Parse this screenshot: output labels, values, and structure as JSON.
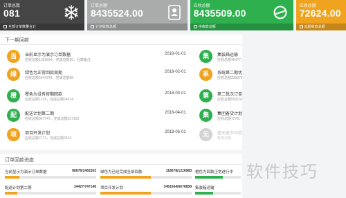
{
  "colors": {
    "black_card": "#454545",
    "grey_card": "#a9acab",
    "green_card": "#2eb04e",
    "orange_card": "#f0a31f",
    "orange_circle": "#f0a31f",
    "green_circle": "#2eb04e",
    "grey_circle": "#d3d3d3",
    "progress_orange": "#f0a31f",
    "progress_green": "#2eb04e"
  },
  "cards": [
    {
      "title": "订单总数",
      "value": "081",
      "footer": "全部订单数量合计",
      "icon": "snowflake-icon"
    },
    {
      "title": "订单总额",
      "value": "8435524.00",
      "footer": "计划收款总额",
      "icon": "contact-card-icon"
    },
    {
      "title": "应收总额",
      "value": "8435509.00",
      "footer": "待收款总额",
      "icon": "refresh-icon"
    },
    {
      "title": "应收总额",
      "value": "72624.00",
      "footer": "延期收款总额",
      "icon": ""
    }
  ],
  "period": {
    "title": "下一期回款",
    "left": [
      {
        "badge": "当",
        "name": "当前显示为演示订单数据",
        "sub": "应收总额1353564，完成总额25，回款备注",
        "date": "2018-01-01"
      },
      {
        "badge": "绿",
        "name": "绿色为正常回款周期",
        "sub": "应收总额5444378，完成总额98",
        "date": "2018-02-01"
      },
      {
        "badge": "橙",
        "name": "橙色为没有按期回款",
        "sub": "应收总额1218，完成总额64614",
        "date": "2018-03-01"
      },
      {
        "badge": "配",
        "name": "配送计划第二期",
        "sub": "应收总额347747，完成总额227155",
        "date": "2018-04-01"
      },
      {
        "badge": "项",
        "name": "项目开发计划",
        "sub": "应收总额7171，完成总额2543",
        "date": "2018-05-01"
      }
    ],
    "right": [
      {
        "badge": "集",
        "name": "集装箱运输",
        "sub": "应收总额45477，完成总额665881"
      },
      {
        "badge": "系",
        "name": "系统第二期优化订单",
        "sub": "应收总额3358745，完成总额84365"
      },
      {
        "badge": "第",
        "name": "第二批次订单",
        "sub": "应收总额553156，完成总额187"
      },
      {
        "badge": "集",
        "name": "集团备货计划",
        "sub": "应收总额7278，完成总额261"
      },
      {
        "badge": "无",
        "name": "暂无更多回款提醒",
        "sub": "暂无记录"
      }
    ]
  },
  "progress": {
    "title": "订单回款进度",
    "items": [
      {
        "name": "当前显示为演示订单数据",
        "value": "86676/1462263",
        "ratio": 0.16
      },
      {
        "name": "绿色为已经完成全部回款",
        "value": "118678/1216983",
        "ratio": 0.55
      },
      {
        "name": "橙色为回款正常进行中",
        "value": "",
        "ratio": 0.6
      },
      {
        "name": "配送计划第二期",
        "value": "34427/747148",
        "ratio": 0.14
      },
      {
        "name": "项目开发计划",
        "value": "3461664/6676858",
        "ratio": 0.55
      },
      {
        "name": "集装箱运输",
        "value": "",
        "ratio": 0.4
      }
    ]
  },
  "watermark": "软件技巧"
}
